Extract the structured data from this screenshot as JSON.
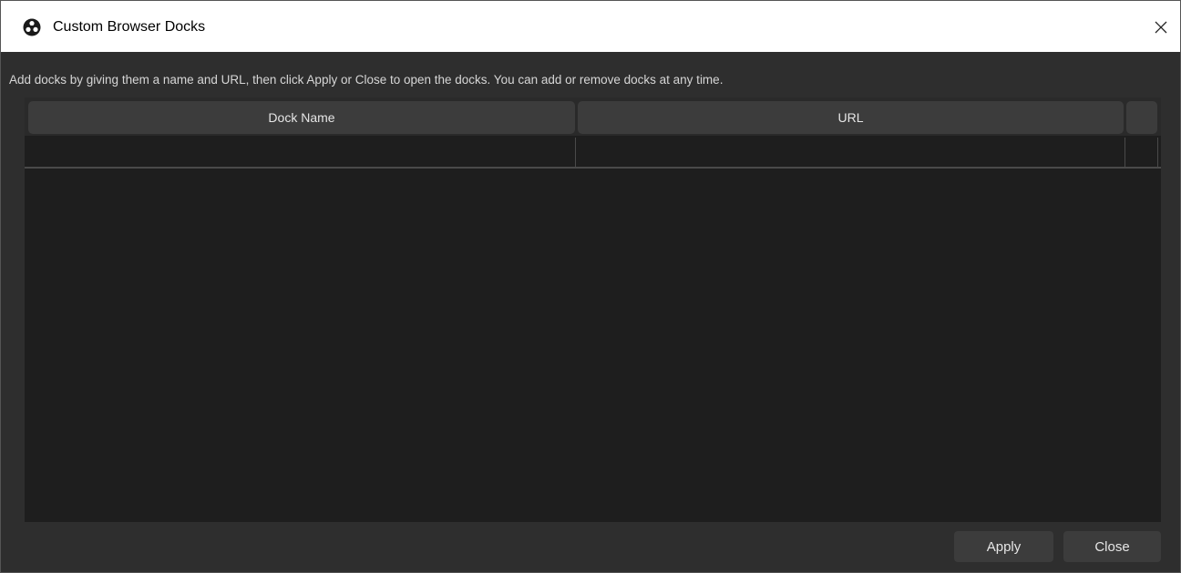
{
  "window": {
    "title": "Custom Browser Docks",
    "close_icon": "close-icon",
    "app_icon": "obs-logo-icon"
  },
  "instructions": "Add docks by giving them a name and URL, then click Apply or Close to open the docks. You can add or remove docks at any time.",
  "table": {
    "columns": [
      "Dock Name",
      "URL",
      ""
    ],
    "rows": [
      {
        "name": "",
        "url": ""
      }
    ]
  },
  "buttons": {
    "apply": "Apply",
    "close": "Close"
  },
  "colors": {
    "titlebar": "#ffffff",
    "body": "#2e2e2e",
    "table": "#1e1e1e",
    "header_cell": "#3c3c3c",
    "button": "#3c3c3c",
    "text": "#e6e6e6"
  }
}
